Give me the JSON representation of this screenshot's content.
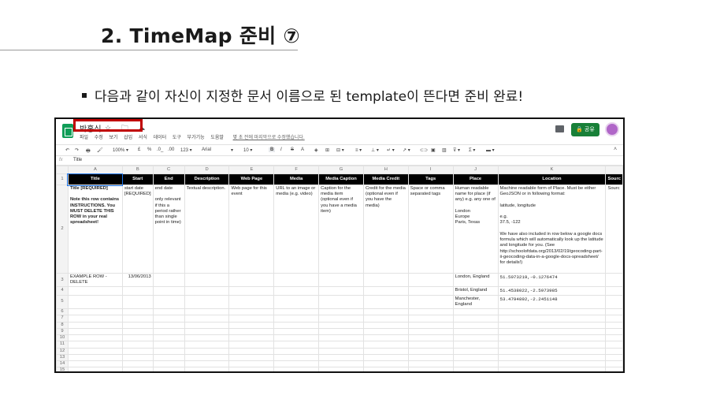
{
  "slide": {
    "title": "2. TimeMap 준비 ⑦",
    "bullet": "다음과 같이 자신이 지정한 문서 이름으로 된 template이 뜬다면 준비 완료!"
  },
  "app": {
    "doc_title": "박홍식",
    "title_icons": "☆ 🗀 ☁",
    "menu": [
      "파일",
      "수정",
      "보기",
      "삽입",
      "서식",
      "데이터",
      "도구",
      "부가기능",
      "도움말"
    ],
    "edit_note": "몇 초 전에 마지막으로 수정했습니다.",
    "share_label": "🔒 공유",
    "toolbar": {
      "undo": "↶",
      "redo": "↷",
      "print": "🖶",
      "paint": "🖌",
      "zoom": "100% ▾",
      "currency": "£",
      "percent": "%",
      "dec_less": ".0_",
      "dec_more": ".00",
      "format": "123 ▾",
      "font": "Arial",
      "font_caret": "▾",
      "size": "10 ▾",
      "bold": "B",
      "italic": "I",
      "strike": "S",
      "color": "A",
      "fill": "◈",
      "borders": "⊞",
      "merge": "⊟ ▾",
      "halign": "≡ ▾",
      "valign": "⊥ ▾",
      "wrap": "↵ ▾",
      "rotate": "↗ ▾",
      "link": "⊂⊃",
      "comment": "▣",
      "chart": "▥",
      "filter": "⊽ ▾",
      "func": "Σ ▾",
      "input": "▬ ▾"
    },
    "formula": {
      "fx": "fx",
      "value": "Title"
    }
  },
  "sheet": {
    "columns": [
      "A",
      "B",
      "C",
      "D",
      "E",
      "F",
      "G",
      "H",
      "I",
      "J",
      "K",
      ""
    ],
    "headers": [
      "Title",
      "Start",
      "End",
      "Description",
      "Web Page",
      "Media",
      "Media Caption",
      "Media Credit",
      "Tags",
      "Place",
      "Location",
      "Sourc"
    ],
    "row_numbers": [
      "1",
      "2",
      "3",
      "4",
      "5",
      "6",
      "7",
      "8",
      "9",
      "10",
      "11",
      "12",
      "13",
      "14",
      "15"
    ],
    "row2": [
      "Title [REQUIRED]\n\nNote this row contains INSTRUCTIONS. You MUST DELETE THIS ROW in your real spreadsheet!",
      "start date [REQUIRED]",
      "end date\n\nonly relevant if this a period rather than single point in time)",
      "Textual description.",
      "Web page for this event",
      "URL to an image or media (e.g. video)",
      "Caption for the media item (optional even if you have a media item)",
      "Credit for the media (optional even if you have the media)",
      "Space or comma separated tags",
      "Human readable name for place (if any) e.g. any one of\n\nLondon\nEurope\nParis, Texas",
      "Machine readable form of Place. Must be either GeoJSON or in following format:\n\nlatitude, longitude\n\ne.g.\n37.5, -122\n\nWe have also included in row below a google docs formula which will automatically look up the latitude and longitude for you. (See http://schoolofdata.org/2013/02/19/geocoding-part-ii-geocoding-data-in-a-google-docs-spreadsheet/ for details!)",
      "Sourc"
    ],
    "row3": [
      "EXAMPLE ROW - DELETE",
      "13/06/2013",
      "",
      "",
      "",
      "",
      "",
      "",
      "",
      "London, England",
      "51.5073219,-0.1276474",
      ""
    ],
    "row4": [
      "",
      "",
      "",
      "",
      "",
      "",
      "",
      "",
      "",
      "Bristol, England",
      "51.4538022,-2.5973985",
      ""
    ],
    "row5": [
      "",
      "",
      "",
      "",
      "",
      "",
      "",
      "",
      "",
      "Manchester, England",
      "53.4794892,-2.2451148",
      ""
    ]
  }
}
